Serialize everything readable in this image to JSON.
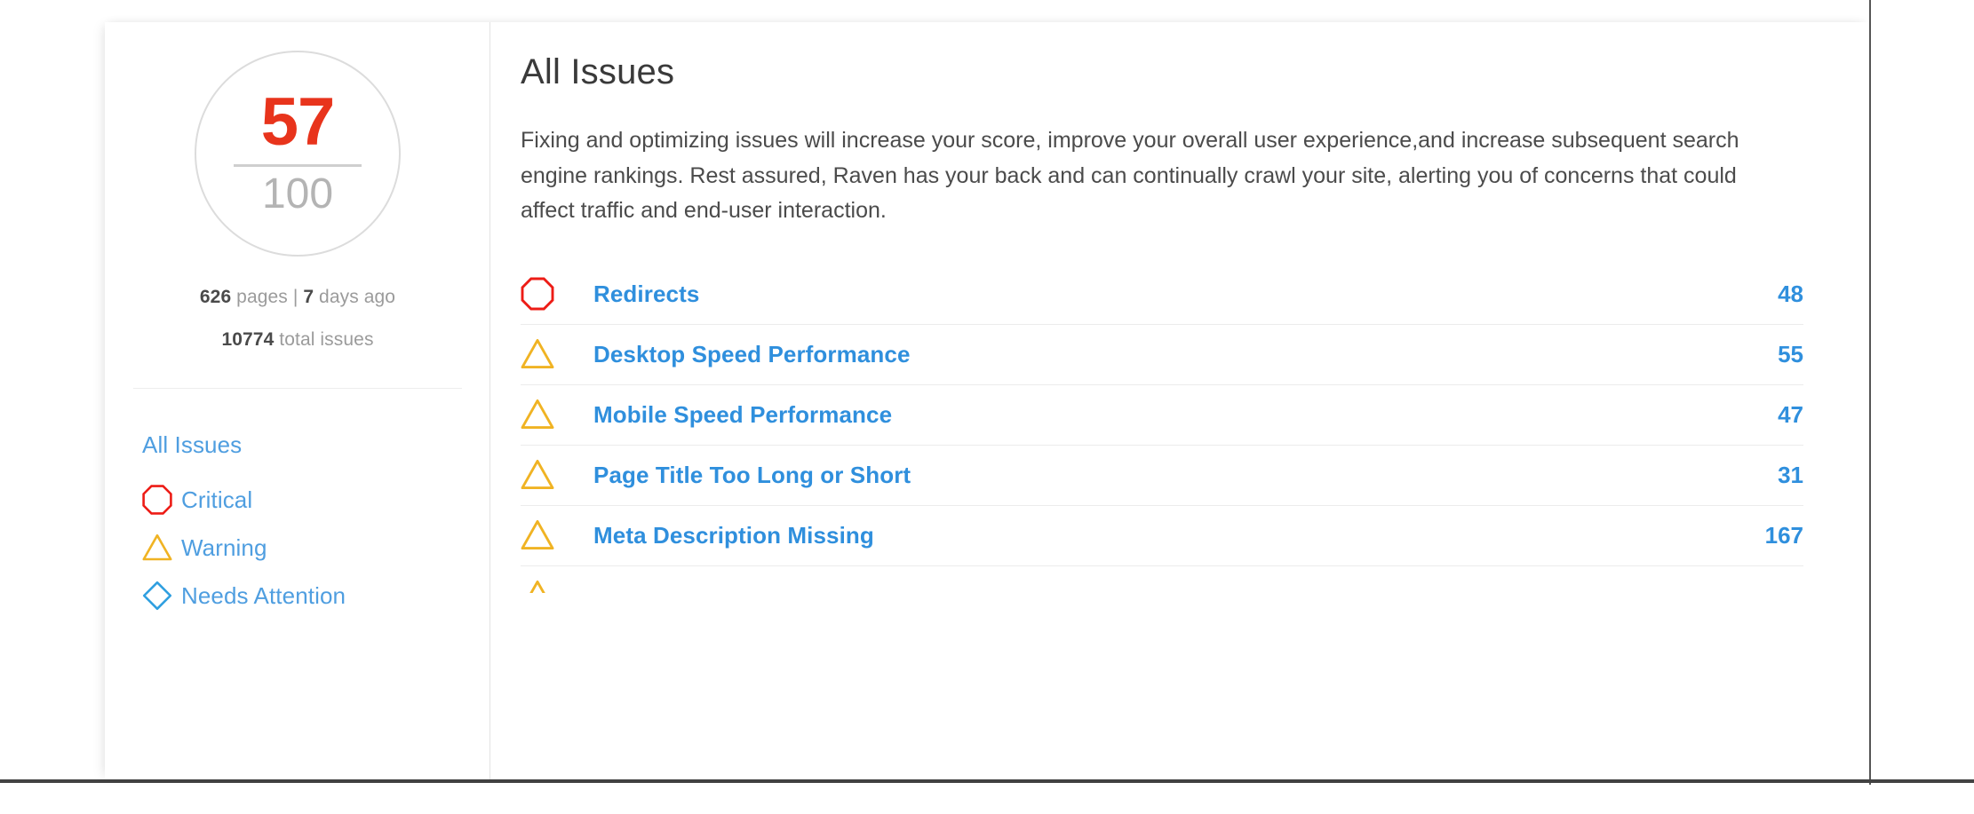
{
  "score": {
    "value": "57",
    "max": "100",
    "value_color": "#e8341c",
    "max_color": "#b4b4b4"
  },
  "stats": {
    "pages_count": "626",
    "pages_label": " pages | ",
    "crawled_number": "7",
    "crawled_label": " days ago",
    "total_issues_count": "10774",
    "total_issues_label": " total issues"
  },
  "sidebar": {
    "items": [
      {
        "label": "All Issues",
        "icon": "none"
      },
      {
        "label": "Critical",
        "icon": "octagon-icon",
        "color": "#ed1c16"
      },
      {
        "label": "Warning",
        "icon": "triangle-icon",
        "color": "#f0b323"
      },
      {
        "label": "Needs Attention",
        "icon": "diamond-icon",
        "color": "#2f9fe0"
      }
    ]
  },
  "main": {
    "title": "All Issues",
    "intro": "Fixing and optimizing issues will increase your score, improve your overall user experience,and increase subsequent search engine rankings. Rest assured, Raven has your back and can continually crawl your site, alerting you of concerns that could affect traffic and end-user interaction.",
    "issues": [
      {
        "label": "Redirects",
        "count": "48",
        "severity": "critical",
        "icon": "octagon-icon"
      },
      {
        "label": "Desktop Speed Performance",
        "count": "55",
        "severity": "warning",
        "icon": "triangle-icon"
      },
      {
        "label": "Mobile Speed Performance",
        "count": "47",
        "severity": "warning",
        "icon": "triangle-icon"
      },
      {
        "label": "Page Title Too Long or Short",
        "count": "31",
        "severity": "warning",
        "icon": "triangle-icon"
      },
      {
        "label": "Meta Description Missing",
        "count": "167",
        "severity": "warning",
        "icon": "triangle-icon"
      },
      {
        "label": "",
        "count": "",
        "severity": "warning",
        "icon": "triangle-icon"
      }
    ]
  },
  "colors": {
    "link_blue": "#2f8fdd",
    "nav_blue": "#4f9ee0",
    "critical_red": "#ed1c16",
    "warning_yellow": "#f0b323",
    "attention_blue": "#2f9fe0",
    "score_red": "#e8341c"
  }
}
